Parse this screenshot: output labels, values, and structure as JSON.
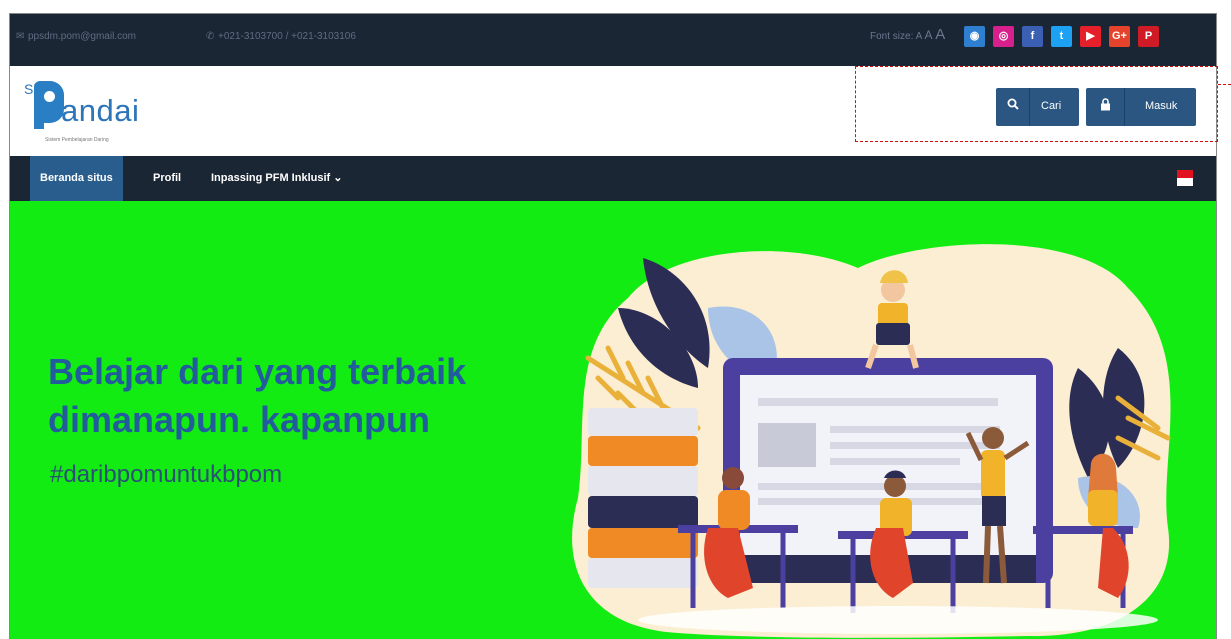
{
  "topbar": {
    "email": "ppsdm.pom@gmail.com",
    "phone": "+021-3103700 / +021-3103106",
    "font_size_label": "Font size:",
    "font_a_small": "A",
    "font_a_medium": "A",
    "font_a_large": "A"
  },
  "social": [
    {
      "icon": "globe-icon",
      "glyph": "◉",
      "color": "#2f7fd0"
    },
    {
      "icon": "instagram-icon",
      "glyph": "◎",
      "color": "#d8208d"
    },
    {
      "icon": "facebook-icon",
      "glyph": "f",
      "color": "#3b5fb3"
    },
    {
      "icon": "twitter-icon",
      "glyph": "t",
      "color": "#1da1f2"
    },
    {
      "icon": "youtube-icon",
      "glyph": "▶",
      "color": "#e6202a"
    },
    {
      "icon": "google-plus-icon",
      "glyph": "G+",
      "color": "#e5432c"
    },
    {
      "icon": "pinterest-icon",
      "glyph": "P",
      "color": "#cf1b26"
    }
  ],
  "logo": {
    "si": "Si",
    "name": "andai",
    "tagline": "Sistem Pembelajaran Daring"
  },
  "header": {
    "search_label": "Cari",
    "login_label": "Masuk"
  },
  "nav": {
    "home": "Beranda situs",
    "profile": "Profil",
    "inpassing": "Inpassing PFM Inklusif",
    "inpassing_chevron": "⌄"
  },
  "hero": {
    "headline_line1": "Belajar dari yang terbaik",
    "headline_line2": "dimanapun. kapanpun",
    "hashtag": "#daribpomuntukbpom",
    "background_color": "#12ec12"
  }
}
